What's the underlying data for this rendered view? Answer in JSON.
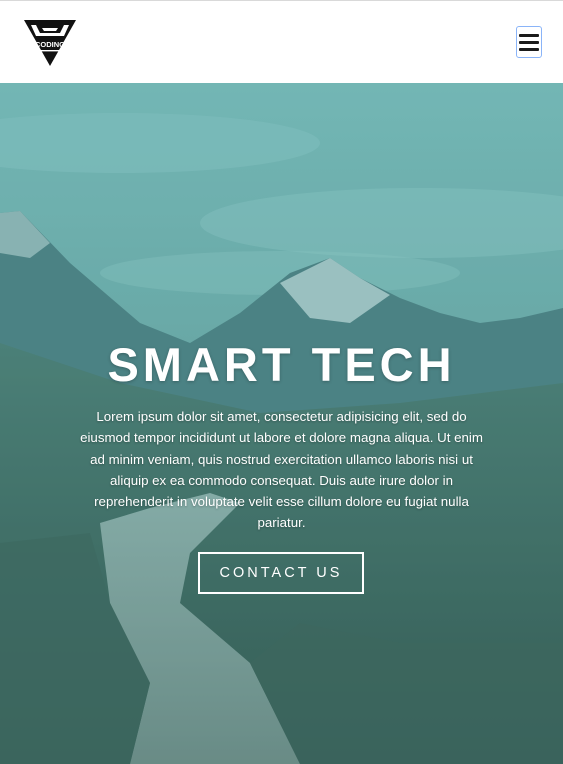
{
  "header": {
    "logo_text": "CODING",
    "menu_button_icon": "hamburger-icon"
  },
  "hero": {
    "title": "SMART TECH",
    "description": "Lorem ipsum dolor sit amet, consectetur adipisicing elit, sed do eiusmod tempor incididunt ut labore et dolore magna aliqua. Ut enim ad minim veniam, quis nostrud exercitation ullamco laboris nisi ut aliquip ex ea commodo consequat. Duis aute irure dolor in reprehenderit in voluptate velit esse cillum dolore eu fugiat nulla pariatur.",
    "cta_label": "CONTACT US"
  },
  "colors": {
    "hero_tint": "#4e9e9c",
    "header_background": "#ffffff",
    "menu_outline": "#8ab4f8"
  }
}
